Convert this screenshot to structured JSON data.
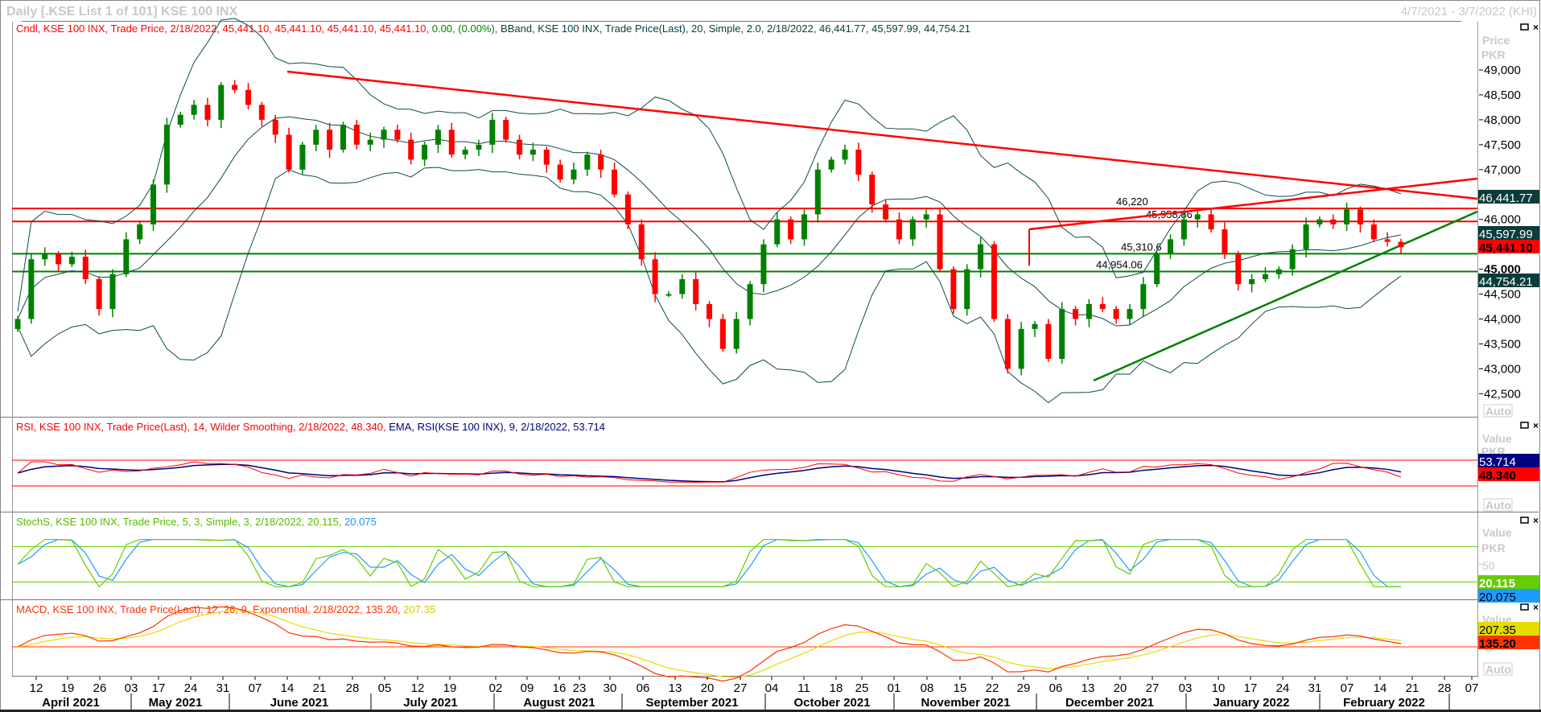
{
  "window": {
    "title": "Daily [.KSE List 1 of 101] KSE 100 INX",
    "date_range": "4/7/2021 - 3/7/2022 (KHI)"
  },
  "panels": {
    "price": {
      "legend": [
        {
          "text": "Cndl, KSE 100 INX, Trade Price, 2/18/2022, 45,441.10, 45,441.10, 45,441.10, 45,441.10, ",
          "color": "#ff0000"
        },
        {
          "text": "0.00, (0.00%), ",
          "color": "#008000"
        },
        {
          "text": "BBand, KSE 100 INX, Trade Price(Last), 20, Simple, 2.0, 2/18/2022, 46,441.77, 45,597.99, 44,754.21",
          "color": "#0b4040"
        }
      ],
      "axis_title": [
        "Price",
        "PKR"
      ],
      "ticks": [
        "49,000",
        "48,500",
        "48,000",
        "47,500",
        "47,000",
        "46,000",
        "45,000",
        "44,500",
        "44,000",
        "43,500",
        "43,000",
        "42,500"
      ],
      "tick_values": [
        49000,
        48500,
        48000,
        47500,
        47000,
        46000,
        45000,
        44500,
        44000,
        43500,
        43000,
        42500
      ],
      "auto_label": "Auto",
      "value_tags": [
        {
          "text": "46,441.77",
          "value": 46441.77,
          "bg": "#0b3b3b",
          "fg": "#ffffff"
        },
        {
          "text": "45,597.99",
          "value": 45597.99,
          "bg": "#0b3b3b",
          "fg": "#ffffff"
        },
        {
          "text": "45,441.10",
          "value": 45441.1,
          "bg": "#ff0000",
          "fg": "#000000"
        },
        {
          "text": "44,754.21",
          "value": 44754.21,
          "bg": "#0b3b3b",
          "fg": "#ffffff"
        }
      ],
      "levels": [
        {
          "label": "46,220",
          "value": 46220,
          "color": "#ff0000"
        },
        {
          "label": "45,958.86",
          "value": 45958.86,
          "color": "#ff0000"
        },
        {
          "label": "45,310.6",
          "value": 45310.6,
          "color": "#008000"
        },
        {
          "label": "44,954.06",
          "value": 44954.06,
          "color": "#008000"
        }
      ]
    },
    "rsi": {
      "legend": [
        {
          "text": "RSI, KSE 100 INX, Trade Price(Last),  14, Wilder Smoothing, 2/18/2022, 48.340, ",
          "color": "#ff0000"
        },
        {
          "text": "EMA, RSI(KSE 100 INX),  9, 2/18/2022, 53.714",
          "color": "#000080"
        }
      ],
      "axis_title": [
        "Value",
        "PKR"
      ],
      "auto_label": "Auto",
      "value_tags": [
        {
          "text": "53.714",
          "bg": "#000080",
          "fg": "#ffffff"
        },
        {
          "text": "48.340",
          "bg": "#ff0000",
          "fg": "#000000"
        }
      ],
      "levels": [
        70,
        30
      ]
    },
    "stoch": {
      "legend": [
        {
          "text": "StochS, KSE 100 INX, Trade Price,  5, 3, Simple, 3, 2/18/2022, 20.115, ",
          "color": "#55bb00"
        },
        {
          "text": "20.075",
          "color": "#1e90ff"
        }
      ],
      "axis_title": [
        "Value",
        "PKR"
      ],
      "tick": "50",
      "value_tags": [
        {
          "text": "20.115",
          "bg": "#66cc00",
          "fg": "#ffffff"
        },
        {
          "text": "20.075",
          "bg": "#1e9bff",
          "fg": "#000000"
        }
      ],
      "levels": [
        80,
        20
      ]
    },
    "macd": {
      "legend": [
        {
          "text": "MACD, KSE 100 INX, Trade Price(Last),  12, 26, 9, Exponential, 2/18/2022, 135.20, ",
          "color": "#ff3300"
        },
        {
          "text": "207.35",
          "color": "#d4c800"
        }
      ],
      "axis_title": [
        "Value"
      ],
      "tick": "0",
      "auto_label": "Auto",
      "value_tags": [
        {
          "text": "207.35",
          "bg": "#e6dc00",
          "fg": "#000000"
        },
        {
          "text": "135.20",
          "bg": "#ff3300",
          "fg": "#000000"
        }
      ]
    }
  },
  "x_axis": {
    "day_ticks": [
      "12",
      "19",
      "26",
      "03",
      "17",
      "24",
      "31",
      "07",
      "14",
      "21",
      "28",
      "05",
      "12",
      "19",
      "02",
      "09",
      "16",
      "23",
      "30",
      "06",
      "13",
      "20",
      "27",
      "04",
      "11",
      "18",
      "25",
      "01",
      "08",
      "15",
      "22",
      "29",
      "06",
      "13",
      "20",
      "27",
      "03",
      "10",
      "17",
      "24",
      "31",
      "07",
      "14",
      "21",
      "28",
      "07"
    ],
    "months": [
      "April 2021",
      "May 2021",
      "June 2021",
      "July 2021",
      "August 2021",
      "September 2021",
      "October 2021",
      "November 2021",
      "December 2021",
      "January 2022",
      "February 2022"
    ]
  },
  "chart_data": {
    "type": "candlestick",
    "title": "KSE 100 INX Daily",
    "ylabel": "Price PKR",
    "ylim": [
      42300,
      49700
    ],
    "x_range": [
      "4/7/2021",
      "3/7/2022"
    ],
    "closes": [
      44000,
      45200,
      45300,
      45100,
      45250,
      44800,
      44200,
      44900,
      45600,
      45900,
      46700,
      47900,
      48100,
      48300,
      48000,
      48700,
      48600,
      48300,
      48000,
      47700,
      47000,
      47500,
      47800,
      47400,
      47900,
      47500,
      47600,
      47800,
      47600,
      47200,
      47500,
      47800,
      47300,
      47400,
      47500,
      48000,
      47600,
      47300,
      47400,
      47100,
      46800,
      47000,
      47300,
      47000,
      46500,
      45900,
      45200,
      44500,
      44500,
      44800,
      44300,
      44000,
      43400,
      44000,
      44700,
      45500,
      46000,
      45600,
      46100,
      47000,
      47200,
      47400,
      46900,
      46300,
      46000,
      45600,
      46000,
      46100,
      45000,
      44200,
      45000,
      45500,
      44000,
      43000,
      43800,
      43900,
      43200,
      44200,
      44000,
      44300,
      44200,
      44000,
      44200,
      44700,
      45300,
      45600,
      46000,
      46100,
      45800,
      45300,
      44700,
      44800,
      44900,
      45000,
      45400,
      45900,
      46000,
      45900,
      46200,
      45900,
      45600,
      45550,
      45441.1
    ],
    "trendlines": [
      {
        "color": "#ff0000",
        "from": [
          "6/14/2021",
          48950
        ],
        "to": [
          "3/7/2022",
          46380
        ]
      },
      {
        "color": "#ff0000",
        "from": [
          "12/1/2021",
          45800
        ],
        "to": [
          "3/7/2022",
          46820
        ]
      },
      {
        "color": "#008000",
        "from": [
          "12/14/2021",
          42800
        ],
        "to": [
          "3/7/2022",
          46200
        ]
      }
    ],
    "bollinger": {
      "upper": 46441.77,
      "middle": 45597.99,
      "lower": 44754.21
    },
    "rsi": {
      "value": 48.34,
      "ema": 53.714
    },
    "stoch": {
      "k": 20.115,
      "d": 20.075
    },
    "macd": {
      "macd": 135.2,
      "signal": 207.35
    }
  }
}
